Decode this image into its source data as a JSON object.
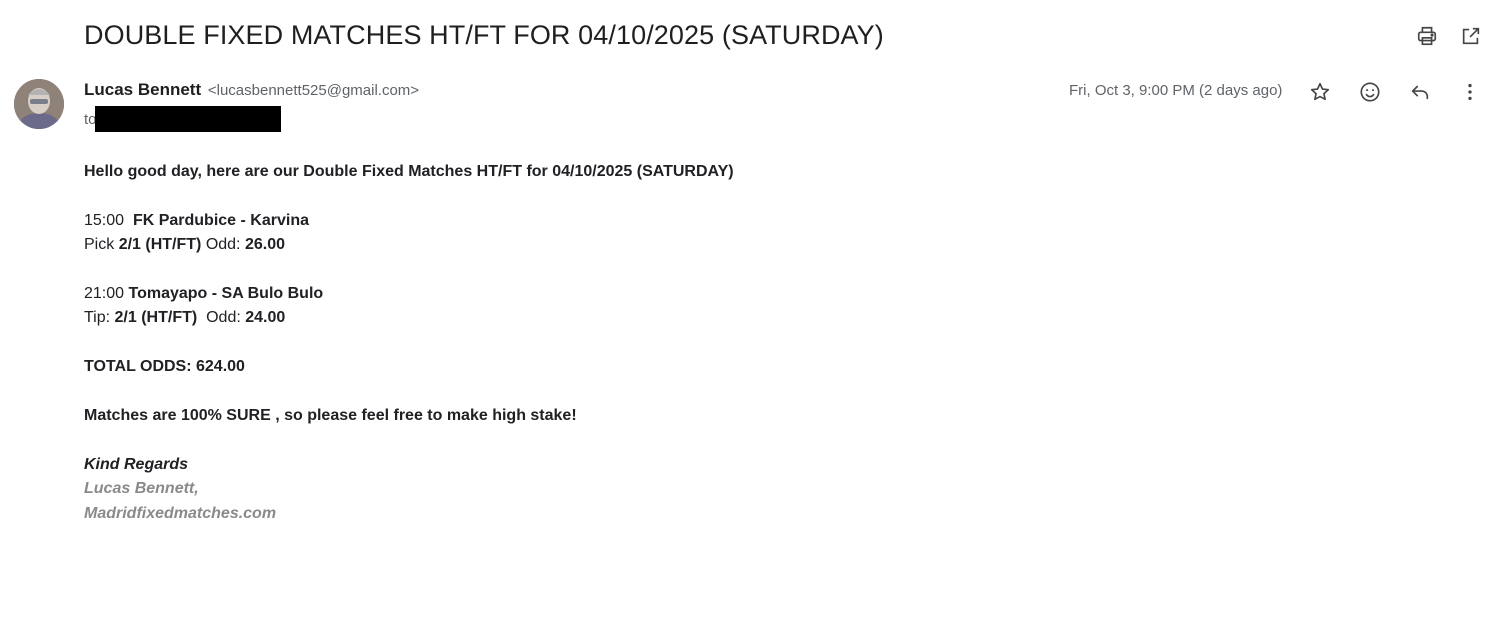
{
  "email": {
    "subject": "DOUBLE FIXED MATCHES HT/FT FOR 04/10/2025 (SATURDAY)",
    "sender_name": "Lucas Bennett",
    "sender_email": "<lucasbennett525@gmail.com>",
    "to_label": "to",
    "date": "Fri, Oct 3, 9:00 PM (2 days ago)"
  },
  "icons": {
    "print": "print-icon",
    "open_new": "open-in-new-icon",
    "star": "star-icon",
    "emoji": "emoji-icon",
    "reply": "reply-icon",
    "more": "more-vert-icon"
  },
  "body": {
    "greeting": "Hello good day, here are our Double Fixed Matches HT/FT for 04/10/2025 (SATURDAY)",
    "match1": {
      "time": "15:00",
      "teams": "FK Pardubice - Karvina",
      "pick_label": "Pick",
      "pick": "2/1 (HT/FT)",
      "odd_label": "Odd:",
      "odd": "26.00"
    },
    "match2": {
      "time": "21:00",
      "teams": "Tomayapo - SA Bulo Bulo",
      "pick_label": "Tip:",
      "pick": "2/1 (HT/FT)",
      "odd_label": "Odd:",
      "odd": "24.00"
    },
    "total": "TOTAL ODDS: 624.00",
    "sure_line": "Matches are 100% SURE , so please feel free to make high stake!",
    "regards": "Kind Regards",
    "sig_name": "Lucas Bennett,",
    "sig_site": "Madridfixedmatches.com"
  }
}
